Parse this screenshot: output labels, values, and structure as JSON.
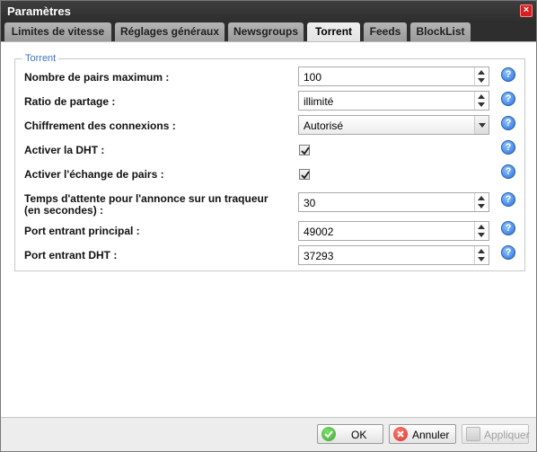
{
  "window": {
    "title": "Paramètres",
    "close_symbol": "×"
  },
  "tabs": [
    {
      "label": "Limites de vitesse"
    },
    {
      "label": "Réglages généraux"
    },
    {
      "label": "Newsgroups"
    },
    {
      "label": "Torrent",
      "active": true
    },
    {
      "label": "Feeds"
    },
    {
      "label": "BlockList"
    }
  ],
  "group": {
    "legend": "Torrent"
  },
  "fields": {
    "max_peers": {
      "label": "Nombre de pairs maximum :",
      "value": "100"
    },
    "share_ratio": {
      "label": "Ratio de partage :",
      "value": "illimité"
    },
    "encryption": {
      "label": "Chiffrement des connexions :",
      "value": "Autorisé"
    },
    "dht": {
      "label": "Activer la DHT :",
      "checked": true
    },
    "pex": {
      "label": "Activer l'échange de pairs :",
      "checked": true
    },
    "announce_wait": {
      "label_line1": "Temps d'attente pour l'annonce sur un traqueur",
      "label_line2": "(en secondes) :",
      "value": "30"
    },
    "main_port": {
      "label": "Port entrant principal :",
      "value": "49002"
    },
    "dht_port": {
      "label": "Port entrant DHT :",
      "value": "37293"
    }
  },
  "help_symbol": "?",
  "buttons": {
    "ok": {
      "label": "OK",
      "icon": "check-icon"
    },
    "cancel": {
      "label": "Annuler",
      "icon": "cancel-icon"
    },
    "apply": {
      "label": "Appliquer",
      "icon": "apply-icon",
      "disabled": true
    }
  },
  "colors": {
    "titlebar": "#2e2e2e",
    "legend": "#4472c4",
    "help": "#2a6fd8",
    "ok_icon": "#3fa832",
    "cancel_icon": "#d9342b"
  }
}
